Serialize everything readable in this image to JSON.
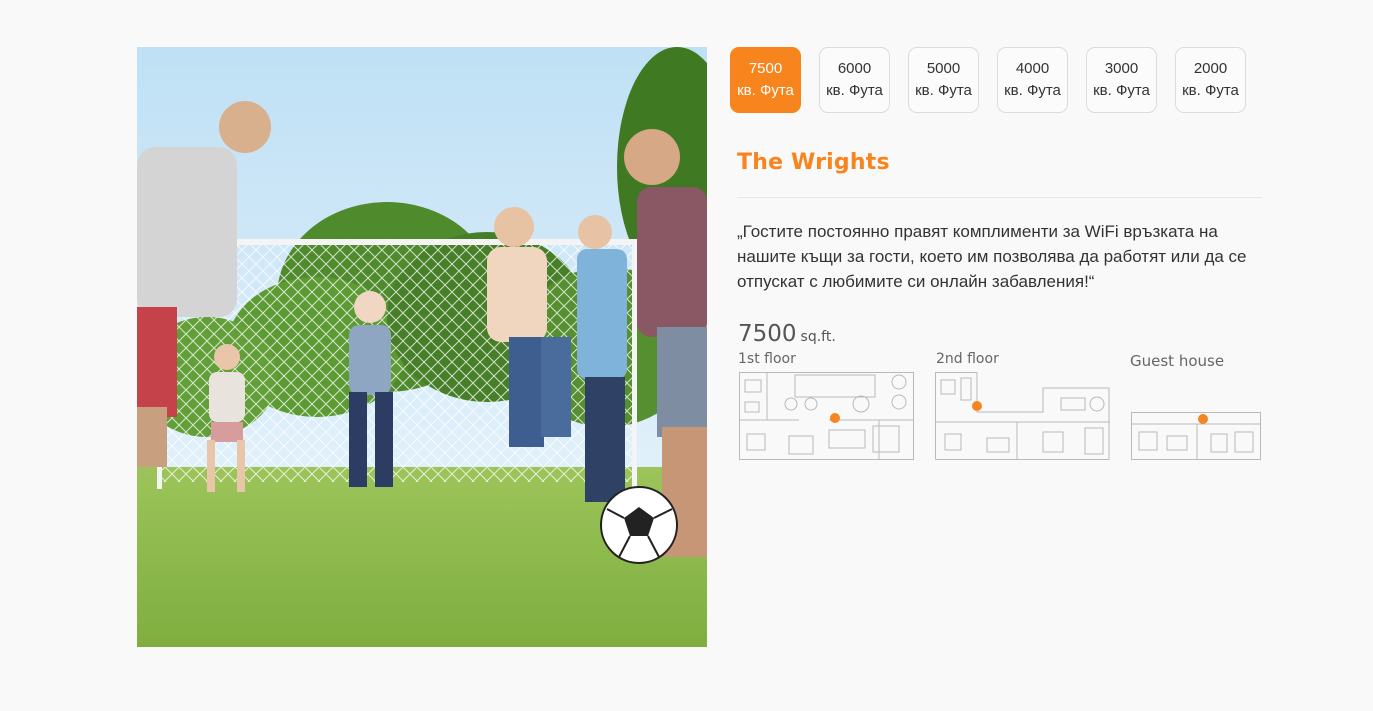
{
  "tabs": [
    {
      "number": "7500",
      "unit": "кв. Фута",
      "active": true
    },
    {
      "number": "6000",
      "unit": "кв. Фута",
      "active": false
    },
    {
      "number": "5000",
      "unit": "кв. Фута",
      "active": false
    },
    {
      "number": "4000",
      "unit": "кв. Фута",
      "active": false
    },
    {
      "number": "3000",
      "unit": "кв. Фута",
      "active": false
    },
    {
      "number": "2000",
      "unit": "кв. Фута",
      "active": false
    }
  ],
  "testimonial": {
    "name": "The Wrights",
    "quote": "„Гостите постоянно правят комплименти за WiFi връзката на нашите къщи за гости, което им позволява да работят или да се отпускат с любимите си онлайн забавления!“"
  },
  "floorplan": {
    "size_number": "7500",
    "size_unit": "sq.ft.",
    "floors": [
      "1st floor",
      "2nd floor",
      "Guest house"
    ]
  },
  "colors": {
    "accent": "#f7841d"
  }
}
